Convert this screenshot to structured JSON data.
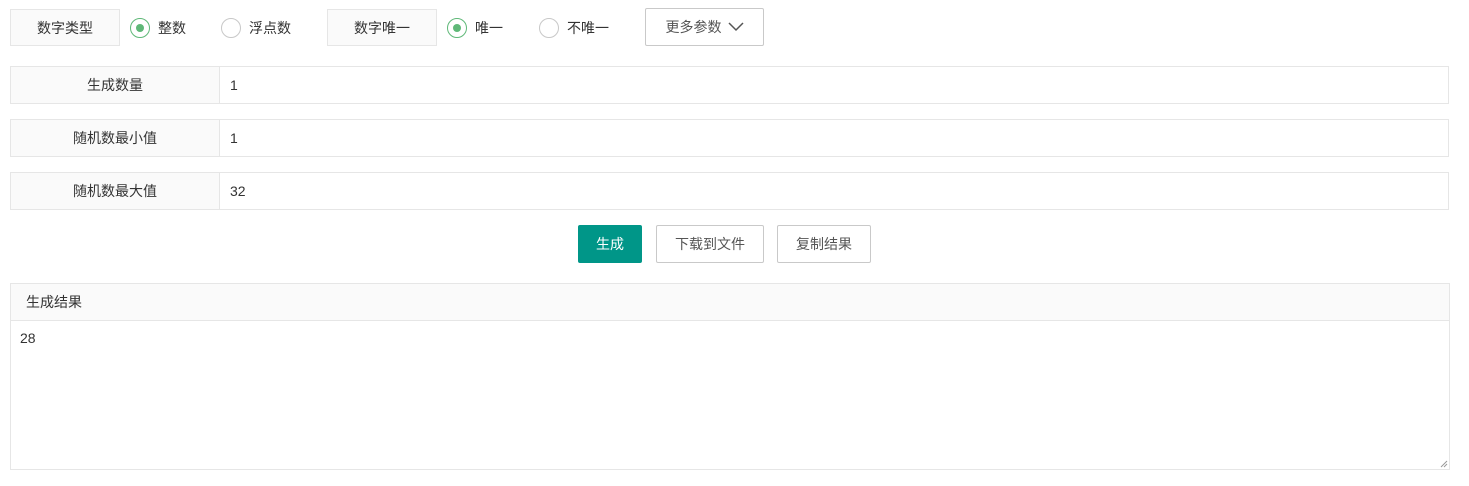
{
  "options": {
    "number_type": {
      "label": "数字类型",
      "choices": [
        {
          "label": "整数",
          "selected": true
        },
        {
          "label": "浮点数",
          "selected": false
        }
      ]
    },
    "number_unique": {
      "label": "数字唯一",
      "choices": [
        {
          "label": "唯一",
          "selected": true
        },
        {
          "label": "不唯一",
          "selected": false
        }
      ]
    },
    "more_params_label": "更多参数",
    "more_params_icon": "chevron-down-icon"
  },
  "form": {
    "count": {
      "label": "生成数量",
      "value": "1"
    },
    "min": {
      "label": "随机数最小值",
      "value": "1"
    },
    "max": {
      "label": "随机数最大值",
      "value": "32"
    }
  },
  "actions": {
    "generate_label": "生成",
    "download_label": "下载到文件",
    "copy_label": "复制结果"
  },
  "result": {
    "title": "生成结果",
    "value": "28"
  },
  "colors": {
    "primary": "#009688",
    "radio_active": "#5fb878",
    "border": "#e6e6e6",
    "label_bg": "#fafafa"
  }
}
